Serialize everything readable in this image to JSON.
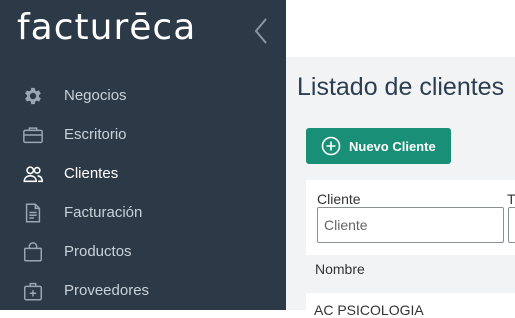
{
  "app": {
    "logo_text": "facturēca",
    "brand_color": "#2fb59a",
    "sidebar_bg": "#2c3a47",
    "accent": "#1a8f78"
  },
  "sidebar": {
    "collapse_icon": "chevron-left-icon",
    "items": [
      {
        "label": "Negocios",
        "icon": "gear-icon"
      },
      {
        "label": "Escritorio",
        "icon": "briefcase-icon"
      },
      {
        "label": "Clientes",
        "icon": "users-icon",
        "active": true
      },
      {
        "label": "Facturación",
        "icon": "document-icon"
      },
      {
        "label": "Productos",
        "icon": "shopping-bag-icon"
      },
      {
        "label": "Proveedores",
        "icon": "medical-bag-icon"
      }
    ]
  },
  "main": {
    "title": "Listado de clientes",
    "new_button": {
      "label": "Nuevo Cliente",
      "icon": "plus-circle-icon"
    },
    "filters": [
      {
        "label": "Cliente",
        "placeholder": "Cliente"
      },
      {
        "label": "T",
        "placeholder": ""
      }
    ],
    "table": {
      "columns": [
        "Nombre"
      ],
      "rows": [
        "AC PSICOLOGIA"
      ]
    }
  }
}
